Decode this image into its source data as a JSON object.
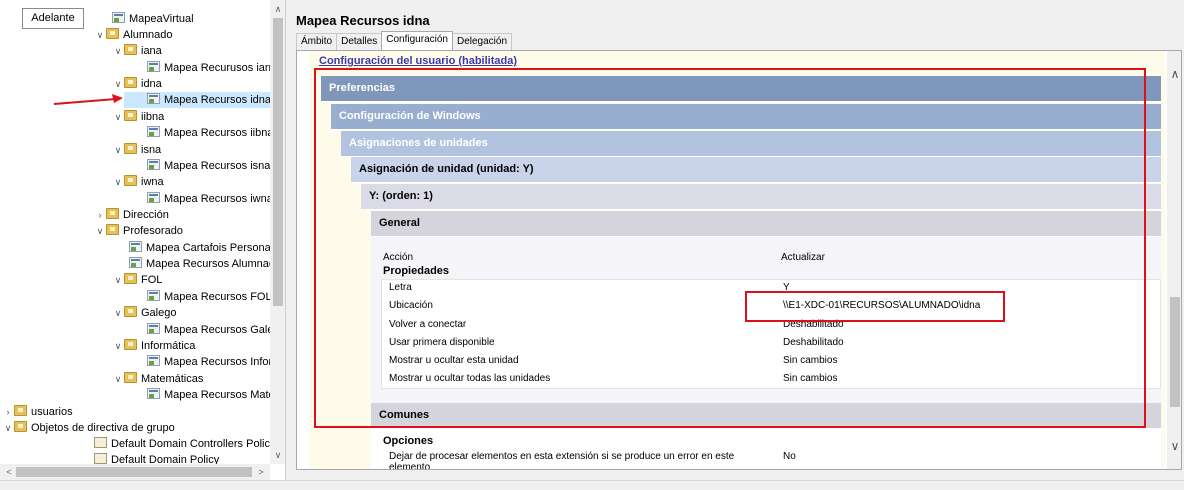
{
  "tooltip": {
    "text": "Adelante"
  },
  "tree": {
    "nodes": [
      {
        "label": "MapeaVirtual"
      },
      {
        "label": "Alumnado"
      },
      {
        "label": "iana"
      },
      {
        "label": "Mapea Recurusos iana"
      },
      {
        "label": "idna"
      },
      {
        "label": "Mapea Recursos idna"
      },
      {
        "label": "iibna"
      },
      {
        "label": "Mapea Recursos iibna"
      },
      {
        "label": "isna"
      },
      {
        "label": "Mapea Recursos isna"
      },
      {
        "label": "iwna"
      },
      {
        "label": "Mapea Recursos iwna"
      },
      {
        "label": "Dirección"
      },
      {
        "label": "Profesorado"
      },
      {
        "label": "Mapea Cartafois Personai"
      },
      {
        "label": "Mapea Recursos Alumnac"
      },
      {
        "label": "FOL"
      },
      {
        "label": "Mapea Recursos FOL"
      },
      {
        "label": "Galego"
      },
      {
        "label": "Mapea Recursos Galeg"
      },
      {
        "label": "Informática"
      },
      {
        "label": "Mapea Recursos Inforı"
      },
      {
        "label": "Matemáticas"
      },
      {
        "label": "Mapea Recursos Mate"
      },
      {
        "label": "usuarios"
      },
      {
        "label": "Objetos de directiva de grupo"
      },
      {
        "label": "Default Domain Controllers Polic"
      },
      {
        "label": "Default Domain Policy"
      }
    ]
  },
  "main": {
    "title": "Mapea Recursos idna",
    "tabs": [
      {
        "label": "Ámbito"
      },
      {
        "label": "Detalles"
      },
      {
        "label": "Configuración"
      },
      {
        "label": "Delegación"
      }
    ],
    "report": {
      "user_config": "Configuración del usuario (habilitada)",
      "preferencias": "Preferencias",
      "config_windows": "Configuración de Windows",
      "asignaciones": "Asignaciones de unidades",
      "asignacion": "Asignación de unidad (unidad: Y)",
      "orden": "Y: (orden: 1)",
      "general": "General",
      "accion_label": "Acción",
      "accion_value": "Actualizar",
      "propiedades": "Propiedades",
      "props": [
        {
          "k": "Letra",
          "v": "Y"
        },
        {
          "k": "Ubicación",
          "v": "\\\\E1-XDC-01\\RECURSOS\\ALUMNADO\\idna"
        },
        {
          "k": "Volver a conectar",
          "v": "Deshabilitado"
        },
        {
          "k": "Usar primera disponible",
          "v": "Deshabilitado"
        },
        {
          "k": "Mostrar u ocultar esta unidad",
          "v": "Sin cambios"
        },
        {
          "k": "Mostrar u ocultar todas las unidades",
          "v": "Sin cambios"
        }
      ],
      "comunes": "Comunes",
      "opciones": "Opciones",
      "opcion_text": "Dejar de procesar elementos en esta extensión si se produce un error en este elemento",
      "opcion_value": "No"
    }
  },
  "colors": {
    "highlight": "#e0101a",
    "selection": "#cce8ff",
    "header_dark": "#7e97ba"
  }
}
